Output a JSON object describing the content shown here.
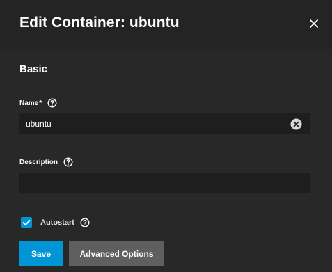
{
  "header": {
    "title": "Edit Container: ubuntu"
  },
  "section": {
    "title": "Basic"
  },
  "fields": {
    "name": {
      "label": "Name",
      "required_marker": "*",
      "value": "ubuntu"
    },
    "description": {
      "label": "Description",
      "value": ""
    },
    "autostart": {
      "label": "Autostart",
      "checked": true
    }
  },
  "actions": {
    "save_label": "Save",
    "advanced_label": "Advanced Options"
  },
  "icons": {
    "close": "close-icon",
    "help": "help-circle-icon",
    "clear": "clear-input-icon",
    "check": "checkmark-icon"
  },
  "colors": {
    "background": "#282828",
    "header": "#242424",
    "accent": "#0095d5",
    "secondary_button": "#5f5f5f",
    "input_background": "#1e1e1e"
  }
}
